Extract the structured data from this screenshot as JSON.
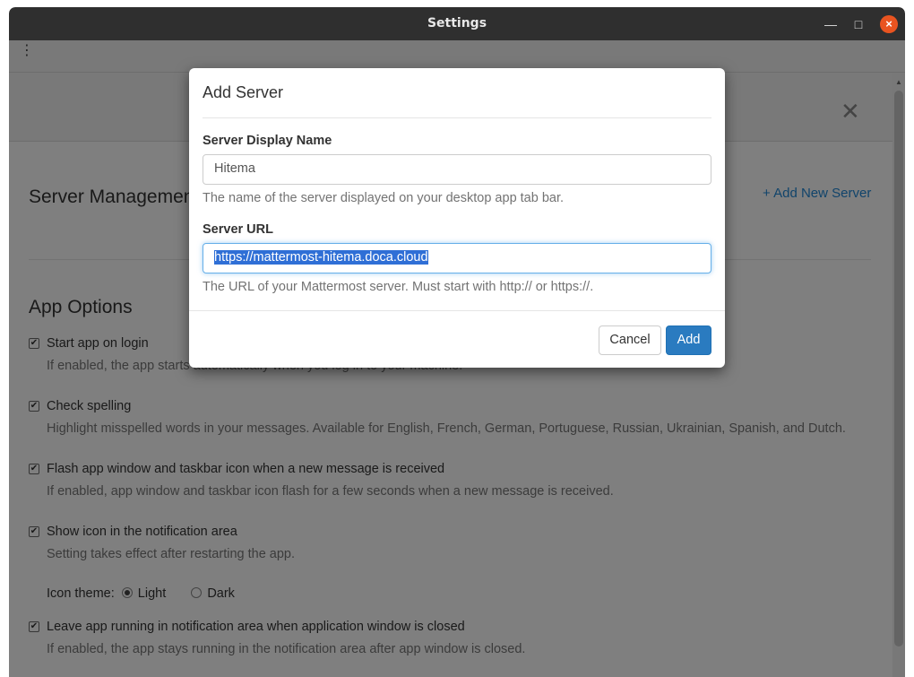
{
  "window": {
    "title": "Settings",
    "minimize_glyph": "—",
    "maximize_glyph": "□",
    "close_glyph": "×"
  },
  "menubar": {
    "menu_glyph": "⋮"
  },
  "settings": {
    "close_glyph": "✕",
    "server_management_heading": "Server Management",
    "add_new_server_link": "+ Add New Server",
    "app_options_heading": "App Options",
    "options": [
      {
        "label": "Start app on login",
        "help": "If enabled, the app starts automatically when you log in to your machine.",
        "checked": true
      },
      {
        "label": "Check spelling",
        "help": "Highlight misspelled words in your messages. Available for English, French, German, Portuguese, Russian, Ukrainian, Spanish, and Dutch.",
        "checked": true
      },
      {
        "label": "Flash app window and taskbar icon when a new message is received",
        "help": "If enabled, app window and taskbar icon flash for a few seconds when a new message is received.",
        "checked": true
      },
      {
        "label": "Show icon in the notification area",
        "help": "Setting takes effect after restarting the app.",
        "checked": true
      },
      {
        "label": "Leave app running in notification area when application window is closed",
        "help": "If enabled, the app stays running in the notification area after app window is closed.",
        "checked": true
      }
    ],
    "icon_theme": {
      "label": "Icon theme:",
      "options": [
        "Light",
        "Dark"
      ],
      "selected": "Light"
    }
  },
  "modal": {
    "title": "Add Server",
    "display_name_label": "Server Display Name",
    "display_name_value": "Hitema",
    "display_name_hint": "The name of the server displayed on your desktop app tab bar.",
    "url_label": "Server URL",
    "url_value": "https://mattermost-hitema.doca.cloud",
    "url_hint": "The URL of your Mattermost server. Must start with http:// or https://.",
    "cancel_label": "Cancel",
    "add_label": "Add"
  },
  "colors": {
    "titlebar": "#2f2f2f",
    "close_button": "#e95420",
    "link": "#2389d7",
    "primary_button": "#2a7bc0",
    "selection": "#2f6fd6"
  }
}
